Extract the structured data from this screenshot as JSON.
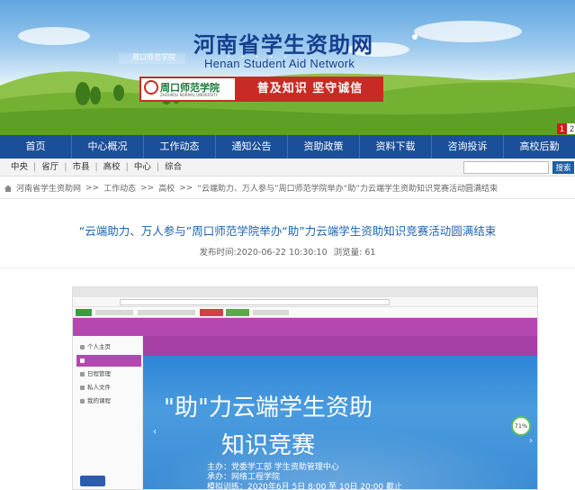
{
  "banner": {
    "title": "河南省学生资助网",
    "subtitle": "Henan Student Aid Network",
    "slides": [
      "1",
      "2"
    ]
  },
  "nav": [
    "首页",
    "中心概况",
    "工作动态",
    "通知公告",
    "资助政策",
    "资料下载",
    "咨询投诉",
    "高校后勤"
  ],
  "subnav": [
    "中央",
    "省厅",
    "市县",
    "高校",
    "中心",
    "综合"
  ],
  "search": {
    "button": "搜索",
    "value": ""
  },
  "breadcrumb": [
    "河南省学生资助网",
    ">>",
    "工作动态",
    ">>",
    "高校",
    ">>",
    "“云端助力、万人参与”周口师范学院举办“助”力云端学生资助知识竞赛活动圆满结束"
  ],
  "article": {
    "title": "“云端助力、万人参与”周口师范学院举办“助”力云端学生资助知识竞赛活动圆满结束",
    "publish_label": "发布时间:",
    "publish_time": "2020-06-22 10:30:10",
    "views_label": "浏览量:",
    "views": "61"
  },
  "screenshot": {
    "left_menu": [
      "个人主页",
      "",
      "日程管理",
      "私人文件",
      "我的课程"
    ],
    "school_name": "周口师范学院",
    "school_en": "ZHOUKOU NORMAL UNIVERSITY",
    "slogan": "普及知识  坚守诚信",
    "hero_line1": "\"助\"力云端学生资助",
    "hero_line2": "知识竞赛",
    "info_lines": [
      "主办：党委学工部  学生资助管理中心",
      "承办：网络工程学院",
      "模拟训练：2020年6月  5日 8:00 至 10日 20:00 截止"
    ],
    "percent": "71%"
  }
}
